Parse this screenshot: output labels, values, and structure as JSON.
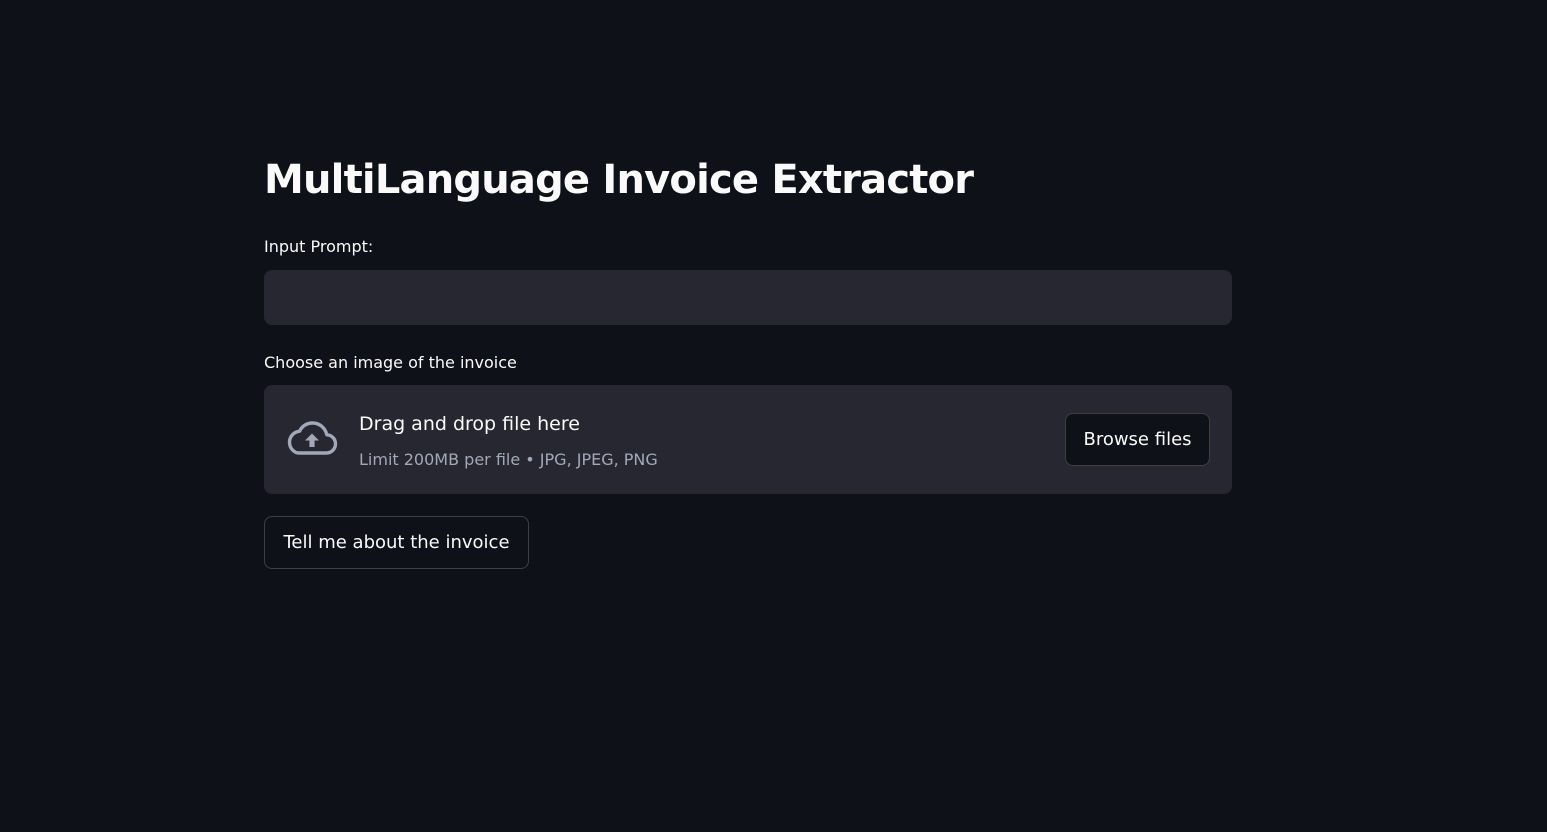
{
  "page": {
    "title": "MultiLanguage Invoice Extractor"
  },
  "prompt": {
    "label": "Input Prompt:",
    "value": "",
    "placeholder": ""
  },
  "uploader": {
    "label": "Choose an image of the invoice",
    "drop_title": "Drag and drop file here",
    "drop_subtitle": "Limit 200MB per file • JPG, JPEG, PNG",
    "browse_label": "Browse files",
    "icon": "cloud-upload-icon"
  },
  "actions": {
    "submit_label": "Tell me about the invoice"
  },
  "colors": {
    "background": "#0e1117",
    "surface": "#262730",
    "text": "#fafafa",
    "muted_text": "#a3a8b8",
    "icon": "#a3a8b8"
  }
}
